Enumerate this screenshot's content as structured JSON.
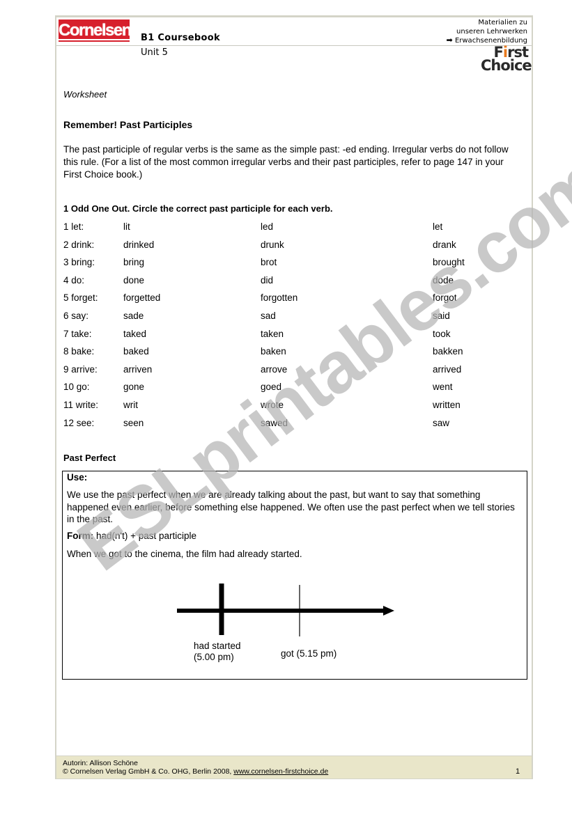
{
  "header": {
    "publisher_logo": "Cornelsen",
    "course_title": "B1 Coursebook",
    "unit": "Unit 5",
    "top_right_lines": [
      "Materialien zu",
      "unseren Lehrwerken"
    ],
    "top_right_link": "Erwachsenenbildung",
    "brand_logo_line1_pre": "F",
    "brand_logo_line1_i": "i",
    "brand_logo_line1_post": "rst",
    "brand_logo_line2": "Choice"
  },
  "worksheet_label": "Worksheet",
  "section1": {
    "title": "Remember! Past Participles",
    "intro": "The past participle of regular verbs is the same as the simple past: -ed ending. Irregular verbs do not follow this rule. (For a list of the most common irregular verbs and their past participles, refer to page 147 in your First Choice book.)"
  },
  "exercise1": {
    "title": "1 Odd One Out. Circle the correct past participle for each verb.",
    "rows": [
      {
        "verb": "1 let:",
        "a": "lit",
        "b": "led",
        "c": "let"
      },
      {
        "verb": "2 drink:",
        "a": "drinked",
        "b": "drunk",
        "c": "drank"
      },
      {
        "verb": "3 bring:",
        "a": "bring",
        "b": "brot",
        "c": "brought"
      },
      {
        "verb": "4 do:",
        "a": "done",
        "b": "did",
        "c": "dode"
      },
      {
        "verb": "5 forget:",
        "a": "forgetted",
        "b": "forgotten",
        "c": "forgot"
      },
      {
        "verb": "6 say:",
        "a": "sade",
        "b": "sad",
        "c": "said"
      },
      {
        "verb": "7 take:",
        "a": "taked",
        "b": "taken",
        "c": "took"
      },
      {
        "verb": "8 bake:",
        "a": "baked",
        "b": "baken",
        "c": "bakken"
      },
      {
        "verb": "9 arrive:",
        "a": "arriven",
        "b": "arrove",
        "c": "arrived"
      },
      {
        "verb": "10 go:",
        "a": "gone",
        "b": "goed",
        "c": "went"
      },
      {
        "verb": "11 write:",
        "a": "writ",
        "b": "wrote",
        "c": "written"
      },
      {
        "verb": "12 see:",
        "a": "seen",
        "b": "sawed",
        "c": "saw"
      }
    ]
  },
  "past_perfect": {
    "title": "Past Perfect",
    "use_label": "Use:",
    "use_text": "We use the past perfect when we are already talking about the past, but want to say that something happened even earlier, before something else happened. We often use the past perfect when we tell stories in the past.",
    "form_label": "Form:",
    "form_text": " had(n't) + past participle",
    "example": "When we got to the cinema, the film had already started.",
    "timeline": {
      "event1_line1": "had started",
      "event1_line2": "(5.00 pm)",
      "event2": "got (5.15 pm)"
    }
  },
  "footer": {
    "author": "Autorin: Allison Schöne",
    "copyright": "© Cornelsen Verlag GmbH & Co. OHG, Berlin 2008, ",
    "link": "www.cornelsen-firstchoice.de",
    "page_number": "1"
  },
  "watermark": "ESLprintables.com"
}
